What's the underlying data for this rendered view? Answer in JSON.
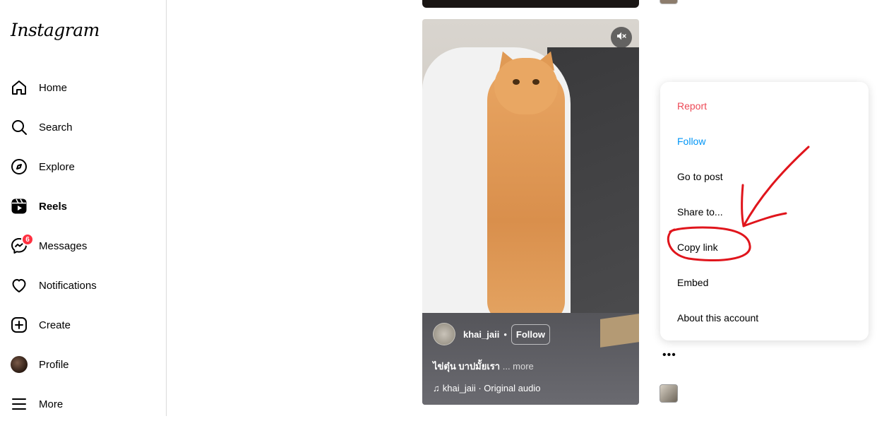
{
  "app": {
    "logo": "Instagram"
  },
  "sidebar": {
    "items": [
      {
        "label": "Home",
        "icon": "home-icon"
      },
      {
        "label": "Search",
        "icon": "search-icon"
      },
      {
        "label": "Explore",
        "icon": "compass-icon"
      },
      {
        "label": "Reels",
        "icon": "reels-icon"
      },
      {
        "label": "Messages",
        "icon": "messenger-icon",
        "badge": "6"
      },
      {
        "label": "Notifications",
        "icon": "heart-icon"
      },
      {
        "label": "Create",
        "icon": "plus-square-icon"
      },
      {
        "label": "Profile",
        "icon": "avatar"
      },
      {
        "label": "More",
        "icon": "hamburger-icon"
      }
    ]
  },
  "reel": {
    "username": "khai_jaii",
    "follow_label": "Follow",
    "caption": "ไข่ตุ๋น บาปมั้ยเรา",
    "more_label": "... more",
    "audio": "khai_jaii · Original audio",
    "muted": true
  },
  "menu": {
    "items": [
      "Report",
      "Follow",
      "Go to post",
      "Share to...",
      "Copy link",
      "Embed",
      "About this account"
    ]
  },
  "colors": {
    "report": "#ed4956",
    "follow": "#0095f6",
    "annotation": "#e0151c",
    "badge": "#ff3040"
  }
}
